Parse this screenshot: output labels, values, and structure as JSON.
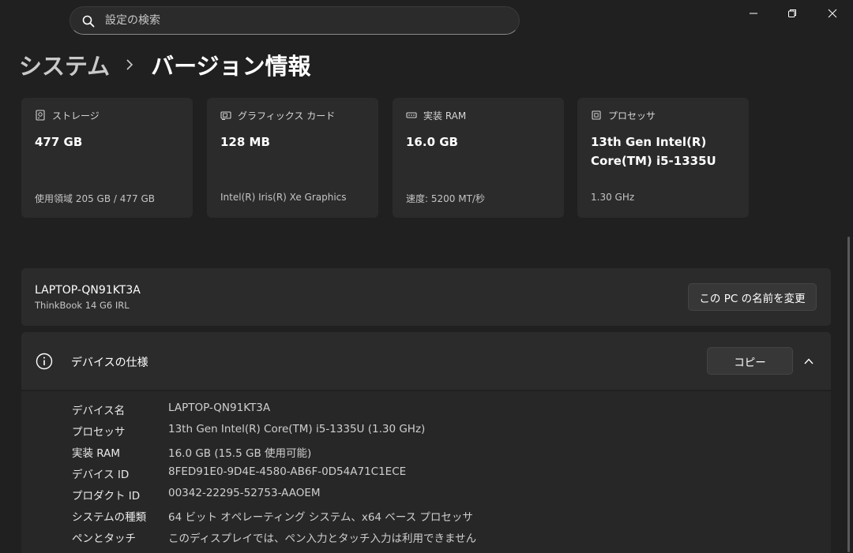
{
  "search": {
    "placeholder": "設定の検索"
  },
  "breadcrumb": {
    "parent": "システム",
    "current": "バージョン情報"
  },
  "cards": [
    {
      "icon": "storage-icon",
      "title": "ストレージ",
      "value": "477 GB",
      "sub": "使用領域 205 GB / 477 GB"
    },
    {
      "icon": "gpu-icon",
      "title": "グラフィックス カード",
      "value": "128 MB",
      "sub": "Intel(R) Iris(R) Xe Graphics"
    },
    {
      "icon": "ram-icon",
      "title": "実装 RAM",
      "value": "16.0 GB",
      "sub": "速度: 5200 MT/秒"
    },
    {
      "icon": "cpu-icon",
      "title": "プロセッサ",
      "value": "13th Gen Intel(R) Core(TM) i5-1335U",
      "sub": "1.30 GHz"
    }
  ],
  "device": {
    "name": "LAPTOP-QN91KT3A",
    "model": "ThinkBook 14 G6 IRL",
    "rename_label": "この PC の名前を変更"
  },
  "specs": {
    "title": "デバイスの仕様",
    "copy_label": "コピー",
    "rows": [
      {
        "label": "デバイス名",
        "value": "LAPTOP-QN91KT3A"
      },
      {
        "label": "プロセッサ",
        "value": "13th Gen Intel(R) Core(TM) i5-1335U (1.30 GHz)"
      },
      {
        "label": "実装 RAM",
        "value": "16.0 GB (15.5 GB 使用可能)"
      },
      {
        "label": "デバイス ID",
        "value": "8FED91E0-9D4E-4580-AB6F-0D54A71C1ECE"
      },
      {
        "label": "プロダクト ID",
        "value": "00342-22295-52753-AAOEM"
      },
      {
        "label": "システムの種類",
        "value": "64 ビット オペレーティング システム、x64 ベース プロセッサ"
      },
      {
        "label": "ペンとタッチ",
        "value": "このディスプレイでは、ペン入力とタッチ入力は利用できません"
      }
    ]
  }
}
